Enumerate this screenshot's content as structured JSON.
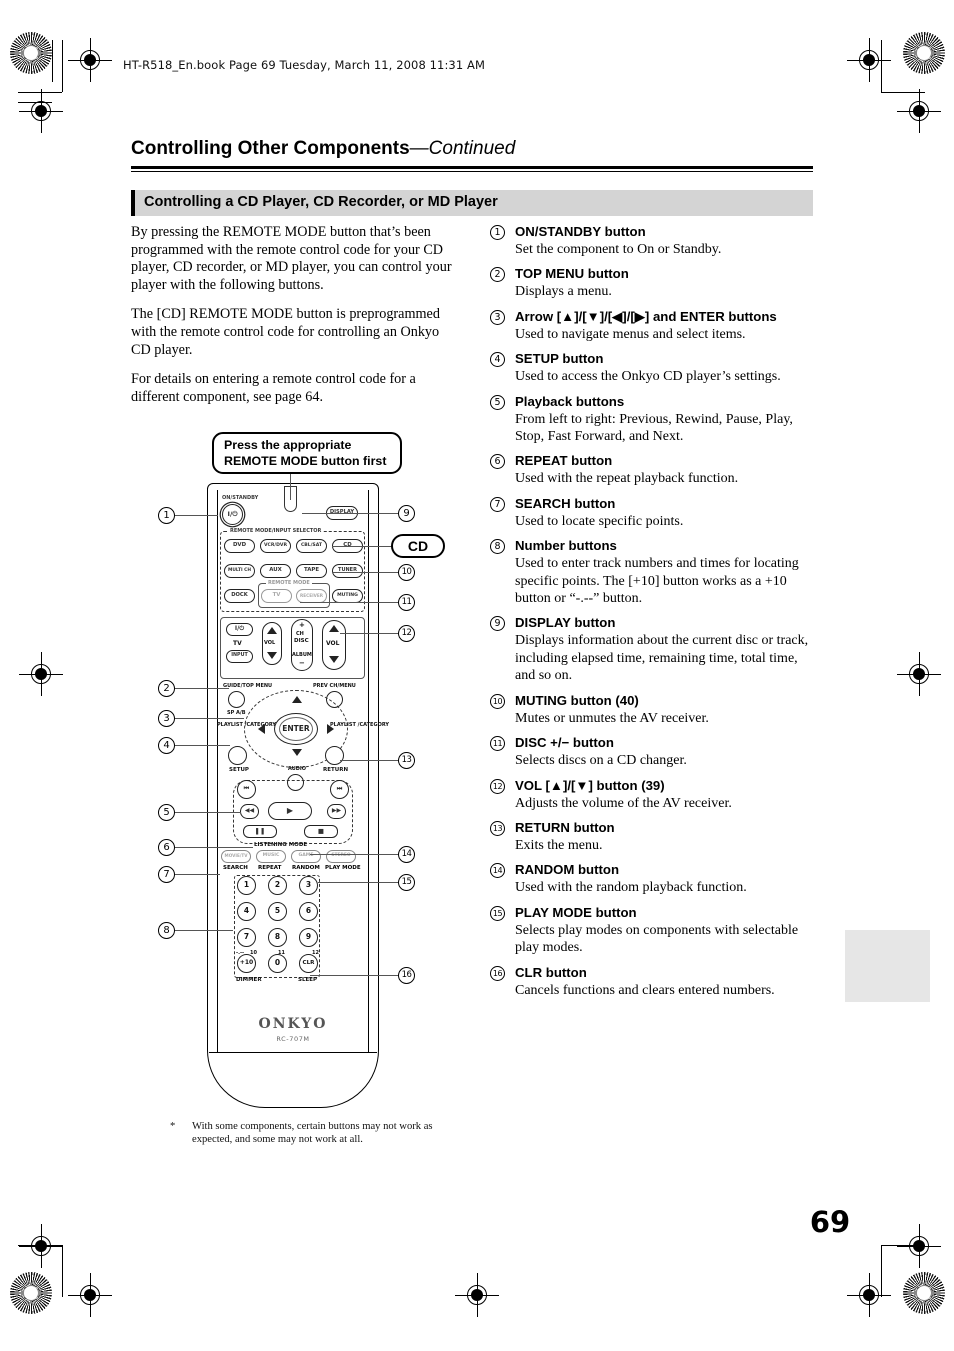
{
  "header": {
    "filestamp": "HT-R518_En.book  Page 69  Tuesday, March 11, 2008  11:31 AM"
  },
  "chapter": {
    "title": "Controlling Other Components",
    "continued": "—Continued"
  },
  "section": {
    "title": "Controlling a CD Player, CD Recorder, or MD Player"
  },
  "intro": {
    "paragraphs": [
      "By pressing the REMOTE MODE button that’s been programmed with the remote control code for your CD player, CD recorder, or MD player, you can control your player with the following buttons.",
      "The [CD] REMOTE MODE button is preprogrammed with the remote control code for controlling an Onkyo CD player.",
      "For details on entering a remote control code for a different component, see page 64."
    ]
  },
  "callout_bubble": {
    "line1": "Press the appropriate",
    "line2": "REMOTE MODE button first"
  },
  "cd_tag": "CD",
  "spec_items": [
    {
      "num": "1",
      "heading": "ON/STANDBY button",
      "body": "Set the component to On or Standby."
    },
    {
      "num": "2",
      "heading": "TOP MENU button",
      "body": "Displays a menu."
    },
    {
      "num": "3",
      "heading": "Arrow [▲]/[▼]/[◀]/[▶] and ENTER buttons",
      "body": "Used to navigate menus and select items."
    },
    {
      "num": "4",
      "heading": "SETUP button",
      "body": "Used to access the Onkyo CD player’s settings."
    },
    {
      "num": "5",
      "heading": "Playback buttons",
      "body": "From left to right: Previous, Rewind, Pause, Play, Stop, Fast Forward, and Next."
    },
    {
      "num": "6",
      "heading": "REPEAT button",
      "body": "Used with the repeat playback function."
    },
    {
      "num": "7",
      "heading": "SEARCH button",
      "body": "Used to locate specific points."
    },
    {
      "num": "8",
      "heading": "Number buttons",
      "body": "Used to enter track numbers and times for locating specific points. The [+10] button works as a +10 button or “-.--” button."
    },
    {
      "num": "9",
      "heading": "DISPLAY button",
      "body": "Displays information about the current disc or track, including elapsed time, remaining time, total time, and so on."
    },
    {
      "num": "10",
      "heading": "MUTING button (40)",
      "body": "Mutes or unmutes the AV receiver."
    },
    {
      "num": "11",
      "heading": "DISC +/− button",
      "body": "Selects discs on a CD changer."
    },
    {
      "num": "12",
      "heading": "VOL [▲]/[▼] button (39)",
      "body": "Adjusts the volume of the AV receiver."
    },
    {
      "num": "13",
      "heading": "RETURN button",
      "body": "Exits the menu."
    },
    {
      "num": "14",
      "heading": "RANDOM button",
      "body": "Used with the random playback function."
    },
    {
      "num": "15",
      "heading": "PLAY MODE button",
      "body": "Selects play modes on components with selectable play modes."
    },
    {
      "num": "16",
      "heading": "CLR button",
      "body": "Cancels functions and clears entered numbers."
    }
  ],
  "remote": {
    "brand": "ONKYO",
    "model": "RC-707M",
    "labels": {
      "on_standby": "ON/STANDBY",
      "power_glyph": "I/⏻",
      "display": "DISPLAY",
      "remote_mode_input_selector": "REMOTE MODE/INPUT SELECTOR",
      "remote_mode": "REMOTE MODE",
      "tv_power_glyph": "I/⏻",
      "tv": "TV",
      "input": "INPUT",
      "vol_small": "VOL",
      "ch": "CH",
      "disc": "DISC",
      "album": "ALBUM",
      "plus": "+",
      "minus": "−",
      "vol_big": "VOL",
      "guide_top_menu": "GUIDE/TOP MENU",
      "sp_ab": "SP A/B",
      "prev_ch_menu": "PREV CH/MENU",
      "playlist_category_left": "PLAYLIST /CATEGORY",
      "playlist_category_right": "PLAYLIST /CATEGORY",
      "enter": "ENTER",
      "setup": "SETUP",
      "audio": "AUDIO",
      "return": "RETURN",
      "listening_mode": "LISTENING MODE",
      "search": "SEARCH",
      "repeat": "REPEAT",
      "random": "RANDOM",
      "play_mode": "PLAY MODE",
      "dimmer": "DIMMER",
      "sleep": "SLEEP",
      "ten_marker": "10",
      "eleven_marker": "11",
      "twelve_marker": "12",
      "dash_marker": "-.--"
    },
    "mode_buttons_row1": [
      "DVD",
      "VCR/DVR",
      "CBL/SAT",
      "CD"
    ],
    "mode_buttons_row2": [
      "MULTI CH",
      "AUX",
      "TAPE",
      "TUNER"
    ],
    "mode_buttons_row3": [
      "DOCK",
      "TV",
      "RECEIVER",
      "MUTING"
    ],
    "listening_mode_buttons": [
      "MOVIE/TV",
      "MUSIC",
      "GAME",
      "STEREO"
    ],
    "number_keys": [
      "1",
      "2",
      "3",
      "4",
      "5",
      "6",
      "7",
      "8",
      "9",
      "+10",
      "0",
      "CLR"
    ]
  },
  "figure_callouts": [
    "1",
    "2",
    "3",
    "4",
    "5",
    "6",
    "7",
    "8",
    "9",
    "10",
    "11",
    "12",
    "13",
    "14",
    "15",
    "16"
  ],
  "footnote": {
    "marker": "*",
    "text": "With some components, certain buttons may not work as expected, and some may not work at all."
  },
  "folio": "69"
}
